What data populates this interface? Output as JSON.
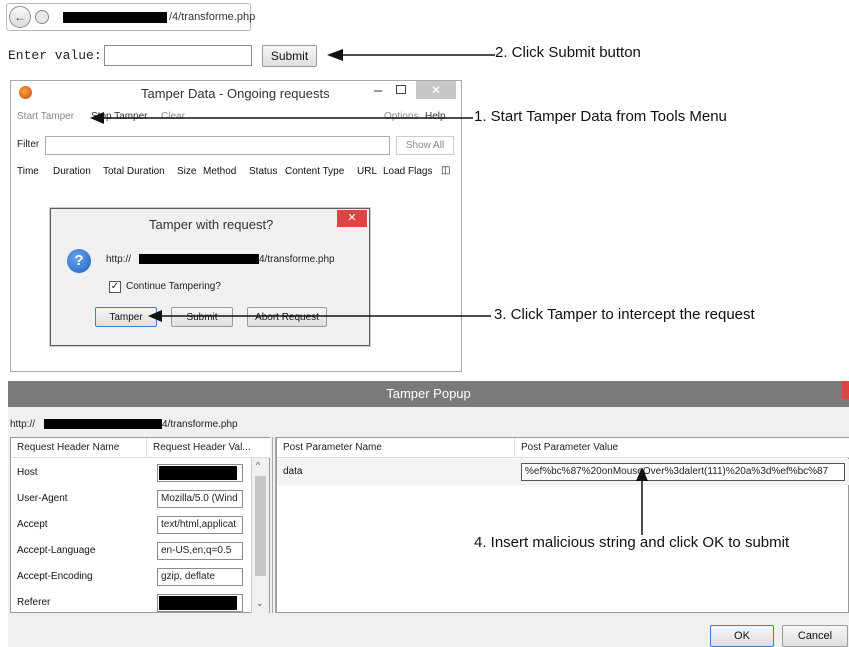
{
  "browser": {
    "url_suffix": "/4/transforme.php",
    "back_icon": "back-arrow-icon",
    "site_icon": "site-identity-icon"
  },
  "form": {
    "label": "Enter value:",
    "input_value": "",
    "submit_label": "Submit"
  },
  "callouts": {
    "step1": "1. Start Tamper Data from Tools Menu",
    "step2": "2. Click Submit button",
    "step3": "3. Click Tamper to intercept the request",
    "step4": "4. Insert malicious string and click OK to submit"
  },
  "tamper_window": {
    "title": "Tamper Data - Ongoing requests",
    "menu": {
      "start_tamper": "Start Tamper",
      "stop_tamper": "Stop Tamper",
      "clear": "Clear",
      "options": "Options",
      "help": "Help"
    },
    "filter_label": "Filter",
    "show_all": "Show All",
    "columns": [
      "Time",
      "Duration",
      "Total Duration",
      "Size",
      "Method",
      "Status",
      "Content Type",
      "URL",
      "Load Flags"
    ]
  },
  "dialog": {
    "title": "Tamper with request?",
    "url_prefix": "http://",
    "url_suffix": "4/transforme.php",
    "checkbox_label": "Continue Tampering?",
    "checkbox_checked": true,
    "buttons": {
      "tamper": "Tamper",
      "submit": "Submit",
      "abort": "Abort Request"
    }
  },
  "popup": {
    "title": "Tamper Popup",
    "url_prefix": "http://",
    "url_suffix": "4/transforme.php",
    "headers": {
      "col_name": "Request Header Name",
      "col_value": "Request Header Val...",
      "rows": [
        {
          "name": "Host",
          "value": ""
        },
        {
          "name": "User-Agent",
          "value": "Mozilla/5.0 (Wind"
        },
        {
          "name": "Accept",
          "value": "text/html,applicat"
        },
        {
          "name": "Accept-Language",
          "value": "en-US,en;q=0.5"
        },
        {
          "name": "Accept-Encoding",
          "value": "gzip, deflate"
        },
        {
          "name": "Referer",
          "value": ""
        }
      ]
    },
    "post": {
      "col_name": "Post Parameter Name",
      "col_value": "Post Parameter Value",
      "rows": [
        {
          "name": "data",
          "value": "%ef%bc%87%20onMouseOver%3dalert(111)%20a%3d%ef%bc%87"
        }
      ]
    },
    "ok": "OK",
    "cancel": "Cancel"
  },
  "colors": {
    "popup_title_bar": "#7a7a7a",
    "close_button": "#e04343",
    "help_icon": "#2c6fcf"
  }
}
